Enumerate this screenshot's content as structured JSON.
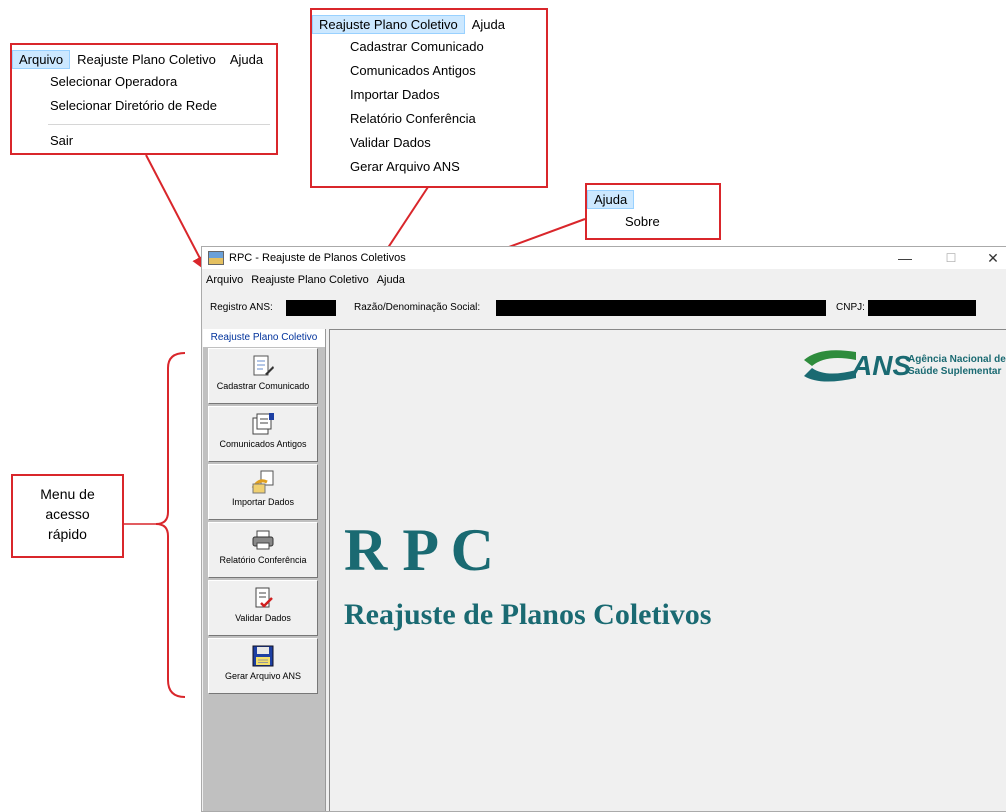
{
  "callout_arquivo": {
    "menubar": [
      "Arquivo",
      "Reajuste Plano Coletivo",
      "Ajuda"
    ],
    "items": [
      "Selecionar Operadora",
      "Selecionar Diretório de Rede"
    ],
    "exit": "Sair"
  },
  "callout_reajuste": {
    "menubar": [
      "Reajuste Plano Coletivo",
      "Ajuda"
    ],
    "items": [
      "Cadastrar Comunicado",
      "Comunicados Antigos",
      "Importar Dados",
      "Relatório Conferência",
      "Validar Dados",
      "Gerar Arquivo ANS"
    ]
  },
  "callout_ajuda": {
    "menubar": "Ajuda",
    "item": "Sobre"
  },
  "window": {
    "title": "RPC - Reajuste de Planos Coletivos",
    "menu": [
      "Arquivo",
      "Reajuste Plano Coletivo",
      "Ajuda"
    ],
    "controls": {
      "minimize": "—",
      "maximize": "☐",
      "close": "✕"
    },
    "info": {
      "registro_label": "Registro ANS:",
      "razao_label": "Razão/Denominação Social:",
      "cnpj_label": "CNPJ:"
    }
  },
  "sidebar": {
    "header": "Reajuste Plano Coletivo",
    "buttons": [
      "Cadastrar Comunicado",
      "Comunicados Antigos",
      "Importar Dados",
      "Relatório Conferência",
      "Validar Dados",
      "Gerar Arquivo ANS"
    ]
  },
  "main": {
    "logo_text": "ANS",
    "logo_sub1": "Agência Nacional de",
    "logo_sub2": "Saúde Suplementar",
    "heading": "R P C",
    "subheading": "Reajuste de Planos Coletivos"
  },
  "annotation": {
    "label": [
      "Menu de",
      "acesso",
      "rápido"
    ]
  },
  "colors": {
    "callout_border": "#d9262b",
    "brand_teal": "#1a6a72",
    "menu_highlight": "#cce8ff"
  }
}
